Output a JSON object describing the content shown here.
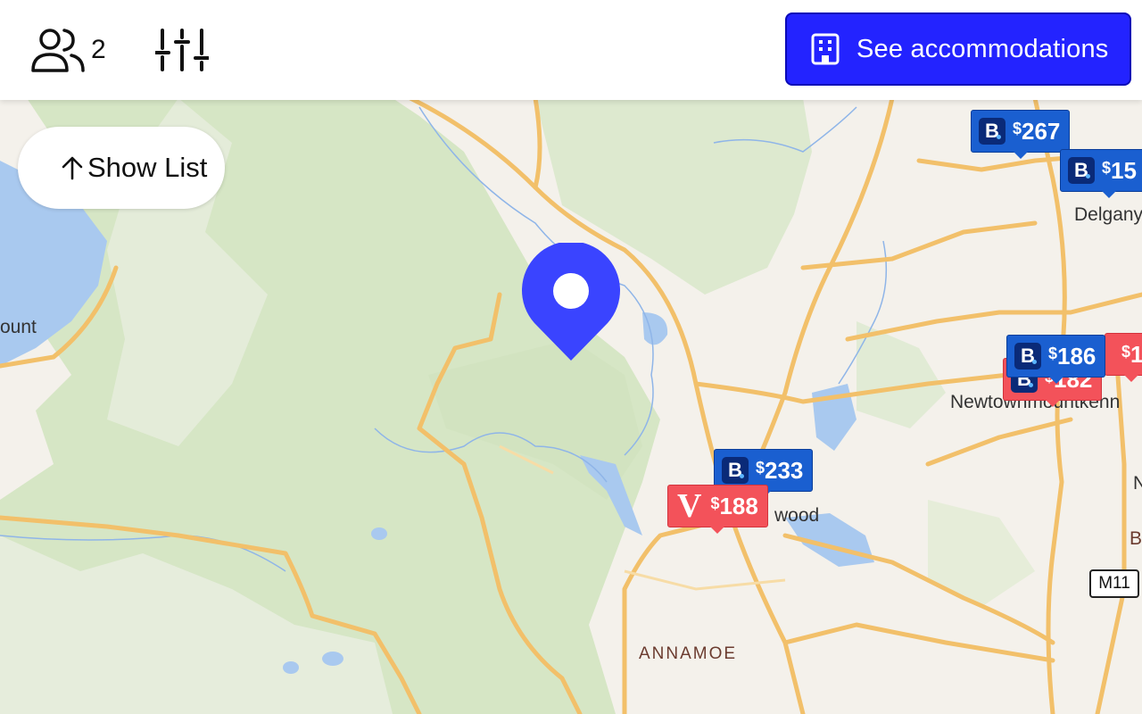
{
  "header": {
    "guests_icon": "people-icon",
    "guest_count": "2",
    "filters_icon": "sliders-icon",
    "cta_icon": "building-icon",
    "cta_label": "See accommodations",
    "cta_color": "#2323ff"
  },
  "map": {
    "show_list_icon": "arrow-up-icon",
    "show_list_label": "Show List",
    "pin_color": "#3a44ff",
    "place_labels": {
      "delgany": "Delgany",
      "newtown": "Newtownmountkenn",
      "roundwood": "wood",
      "annamoe": "ANNAMOE",
      "left_mount": "ount",
      "right_n": "N",
      "right_b": "B"
    },
    "road_shield": "M11",
    "price_markers": [
      {
        "provider": "booking",
        "logo": "B",
        "currency": "$",
        "price": "267"
      },
      {
        "provider": "booking",
        "logo": "B",
        "currency": "$",
        "price": "15"
      },
      {
        "provider": "vrbo",
        "logo": "V",
        "currency": "$",
        "price": "1"
      },
      {
        "provider": "vrbo",
        "logo": "B",
        "currency": "$",
        "price": "182"
      },
      {
        "provider": "booking",
        "logo": "B",
        "currency": "$",
        "price": "186"
      },
      {
        "provider": "booking",
        "logo": "B",
        "currency": "$",
        "price": "233"
      },
      {
        "provider": "vrbo",
        "logo": "V",
        "currency": "$",
        "price": "188"
      }
    ],
    "colors": {
      "booking": "#1a5fd0",
      "vrbo": "#f3525a",
      "forest": "#d9e7c9",
      "water": "#a8c8f0",
      "roads": "#f2c06a"
    }
  }
}
